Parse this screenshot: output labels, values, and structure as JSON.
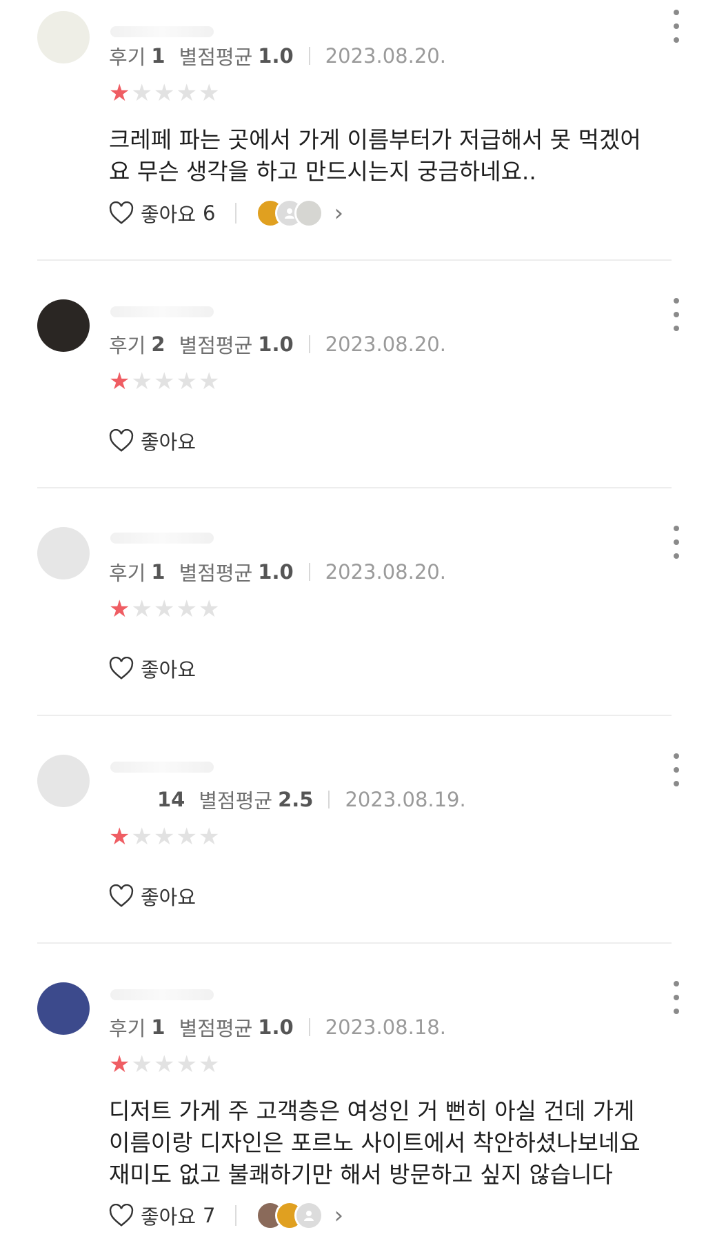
{
  "reviews": [
    {
      "review_label": "후기",
      "review_count": "1",
      "rating_label": "별점평균",
      "rating_avg": "1.0",
      "date": "2023.08.20.",
      "stars": 1,
      "text_lines": [
        "크레페 파는 곳에서 가게 이름부터가 저급해서 못 먹겠어",
        "요 무슨 생각을 하고 만드시는지 궁금하네요.."
      ],
      "like_label": "좋아요",
      "like_count": "6"
    },
    {
      "review_label": "후기",
      "review_count": "2",
      "rating_label": "별점평균",
      "rating_avg": "1.0",
      "date": "2023.08.20.",
      "stars": 1,
      "like_label": "좋아요"
    },
    {
      "review_label": "후기",
      "review_count": "1",
      "rating_label": "별점평균",
      "rating_avg": "1.0",
      "date": "2023.08.20.",
      "stars": 1,
      "like_label": "좋아요"
    },
    {
      "review_count": "14",
      "rating_label": "별점평균",
      "rating_avg": "2.5",
      "date": "2023.08.19.",
      "stars": 1,
      "like_label": "좋아요"
    },
    {
      "review_label": "후기",
      "review_count": "1",
      "rating_label": "별점평균",
      "rating_avg": "1.0",
      "date": "2023.08.18.",
      "stars": 1,
      "text_lines": [
        "디저트 가게 주 고객층은 여성인 거 뻔히 아실 건데 가게",
        "이름이랑 디자인은 포르노 사이트에서 착안하셨나보네요",
        "재미도 없고 불쾌하기만 해서 방문하고 싶지 않습니다"
      ],
      "like_label": "좋아요",
      "like_count": "7"
    }
  ],
  "colors": {
    "star_on": "#ef5d63",
    "star_off": "#e2e2e2",
    "meta_text": "#6f6f6f",
    "date_text": "#9a9a9a"
  },
  "icons": {
    "like": "heart-outline-icon",
    "more": "more-vertical-icon",
    "chevron": "chevron-right-icon",
    "star": "star-icon"
  }
}
